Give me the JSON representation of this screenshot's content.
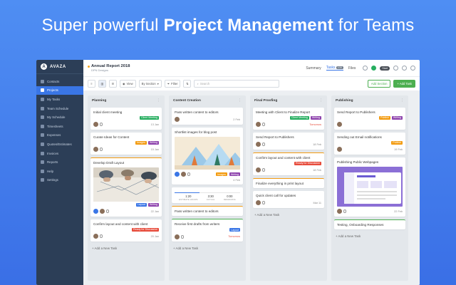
{
  "hero": {
    "pre": "Super powerful ",
    "bold": "Project Management",
    "post": " for Teams"
  },
  "sidebar": {
    "logo": "AVAZA",
    "items": [
      {
        "label": "Contacts"
      },
      {
        "label": "Projects",
        "active": true
      },
      {
        "label": "My Tasks"
      },
      {
        "label": "Team Schedule"
      },
      {
        "label": "My Schedule"
      },
      {
        "label": "Timesheets"
      },
      {
        "label": "Expenses"
      },
      {
        "label": "Quotes/Estimates"
      },
      {
        "label": "Invoices"
      },
      {
        "label": "Reports"
      },
      {
        "label": "Help"
      },
      {
        "label": "Settings"
      }
    ]
  },
  "topbar": {
    "project_title": "Annual Report 2018",
    "project_sub": "DPN Designs",
    "tabs": {
      "summary": "Summary",
      "tasks": "Tasks",
      "tasks_count": "100",
      "files": "Files"
    },
    "timer": "Start"
  },
  "toolbar": {
    "view_label": "View",
    "by_section": "By Section",
    "filter": "Filter",
    "search_placeholder": "Search",
    "add_section": "Add Section",
    "add_task": "+ Add Task"
  },
  "colors": {
    "green_tag": "#27ae60",
    "orange_tag": "#f39c12",
    "purple_tag": "#8e44ad",
    "red_tag": "#e74c3c",
    "blue_tag": "#3a76e6",
    "accent": "#3a76e6"
  },
  "columns": {
    "planning": {
      "title": "Planning",
      "c1": {
        "title": "Initial client meeting",
        "tag": "Client Meeting",
        "date": "13 Jan"
      },
      "c2": {
        "title": "Curate Ideas for Content",
        "tag1": "Images",
        "tag2": "Writing",
        "date": "15 Jan"
      },
      "c3": {
        "title": "Develop Draft Layout",
        "tag": "Layout",
        "tag2": "Writing",
        "date": "22 Jan"
      },
      "c4": {
        "title": "Confirm layout and content with client",
        "tag": "Ready for Discussion",
        "date": "20 Jan"
      },
      "add": "+ Add a New Task"
    },
    "content": {
      "title": "Content Creation",
      "c1": {
        "title": "Pass written content to editors",
        "date": "2 Feb"
      },
      "c2": {
        "title": "Shortlist images for blog post",
        "tag1": "Images",
        "tag2": "Writing",
        "date": "4 Feb"
      },
      "est": {
        "a": "1:20",
        "al": "ESTIMATE HOURS",
        "b": "3:30",
        "bl": "ACTUAL",
        "c": "0:00",
        "cl": "REMAINING"
      },
      "c3": {
        "title": "Pass written content to editors"
      },
      "c4": {
        "title": "Receive first drafts from writers",
        "tag": "Layout",
        "date": "Tomorrow"
      },
      "add": "+ Add a New Task"
    },
    "final": {
      "title": "Final Proofing",
      "c1": {
        "title": "Meeting with Client to Finalize Report",
        "tag": "Client Meeting",
        "tag2": "Writing",
        "date": "Tomorrow"
      },
      "c2": {
        "title": "Send Report to Publishers",
        "date": "18 Feb"
      },
      "c3": {
        "title": "Confirm layout and content with client",
        "tag": "Ready for Discussion",
        "date": "18 Feb"
      },
      "c4": {
        "title": "Finalize everything in print layout"
      },
      "c5": {
        "title": "Quick client call for updates",
        "date": "Mar 11"
      },
      "add": "+ Add a New Task"
    },
    "publishing": {
      "title": "Publishing",
      "c1": {
        "title": "Send Report to Publishers",
        "tag1": "Publish",
        "tag2": "Writing"
      },
      "c2": {
        "title": "Sending out Email notifications",
        "tag": "Publish",
        "date": "19 Feb"
      },
      "c3": {
        "title": "Publishing Public Webpages",
        "date": "22 Feb"
      },
      "c4": {
        "title": "Testing, Onboarding Responses"
      },
      "add": "+ Add a New Task"
    }
  }
}
